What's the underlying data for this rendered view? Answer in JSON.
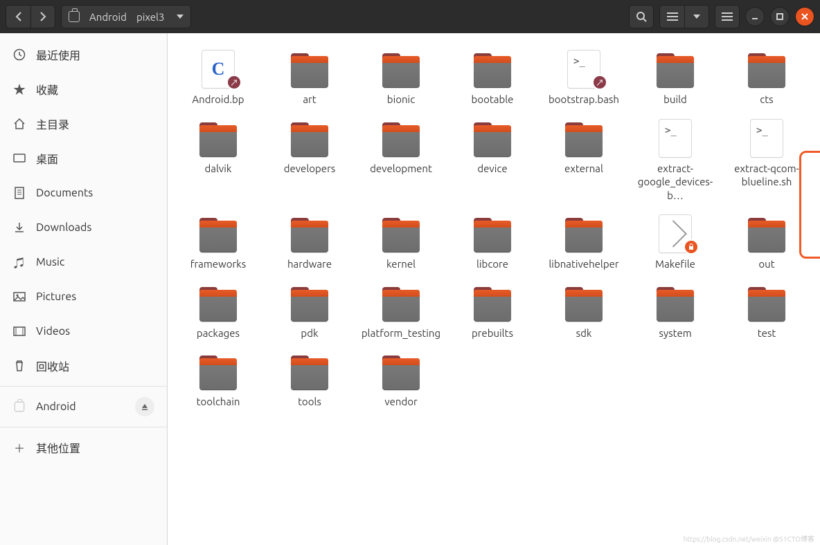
{
  "header": {
    "breadcrumb": [
      "Android",
      "pixel3"
    ]
  },
  "sidebar": {
    "items": [
      {
        "icon": "recent",
        "label": "最近使用"
      },
      {
        "icon": "star",
        "label": "收藏"
      },
      {
        "icon": "home",
        "label": "主目录"
      },
      {
        "icon": "desktop",
        "label": "桌面"
      },
      {
        "icon": "doc",
        "label": "Documents"
      },
      {
        "icon": "download",
        "label": "Downloads"
      },
      {
        "icon": "music",
        "label": "Music"
      },
      {
        "icon": "picture",
        "label": "Pictures"
      },
      {
        "icon": "video",
        "label": "Videos"
      },
      {
        "icon": "trash",
        "label": "回收站"
      }
    ],
    "device": {
      "label": "Android"
    },
    "other": {
      "label": "其他位置"
    }
  },
  "files": [
    {
      "name": "Android.bp",
      "type": "file-c",
      "badge": "link"
    },
    {
      "name": "art",
      "type": "folder"
    },
    {
      "name": "bionic",
      "type": "folder"
    },
    {
      "name": "bootable",
      "type": "folder"
    },
    {
      "name": "bootstrap.bash",
      "type": "file-sh",
      "badge": "link"
    },
    {
      "name": "build",
      "type": "folder"
    },
    {
      "name": "cts",
      "type": "folder"
    },
    {
      "name": "dalvik",
      "type": "folder"
    },
    {
      "name": "developers",
      "type": "folder"
    },
    {
      "name": "development",
      "type": "folder"
    },
    {
      "name": "device",
      "type": "folder"
    },
    {
      "name": "external",
      "type": "folder"
    },
    {
      "name": "extract-google_devices-b…",
      "type": "file-sh"
    },
    {
      "name": "extract-qcom-blueline.sh",
      "type": "file-sh"
    },
    {
      "name": "frameworks",
      "type": "folder"
    },
    {
      "name": "hardware",
      "type": "folder"
    },
    {
      "name": "kernel",
      "type": "folder"
    },
    {
      "name": "libcore",
      "type": "folder"
    },
    {
      "name": "libnativehelper",
      "type": "folder"
    },
    {
      "name": "Makefile",
      "type": "file-make",
      "badge": "lock"
    },
    {
      "name": "out",
      "type": "folder"
    },
    {
      "name": "packages",
      "type": "folder"
    },
    {
      "name": "pdk",
      "type": "folder"
    },
    {
      "name": "platform_testing",
      "type": "folder"
    },
    {
      "name": "prebuilts",
      "type": "folder"
    },
    {
      "name": "sdk",
      "type": "folder"
    },
    {
      "name": "system",
      "type": "folder"
    },
    {
      "name": "test",
      "type": "folder"
    },
    {
      "name": "toolchain",
      "type": "folder"
    },
    {
      "name": "tools",
      "type": "folder"
    },
    {
      "name": "vendor",
      "type": "folder"
    }
  ],
  "watermark": "https://blog.csdn.net/weixin @51CTO博客"
}
